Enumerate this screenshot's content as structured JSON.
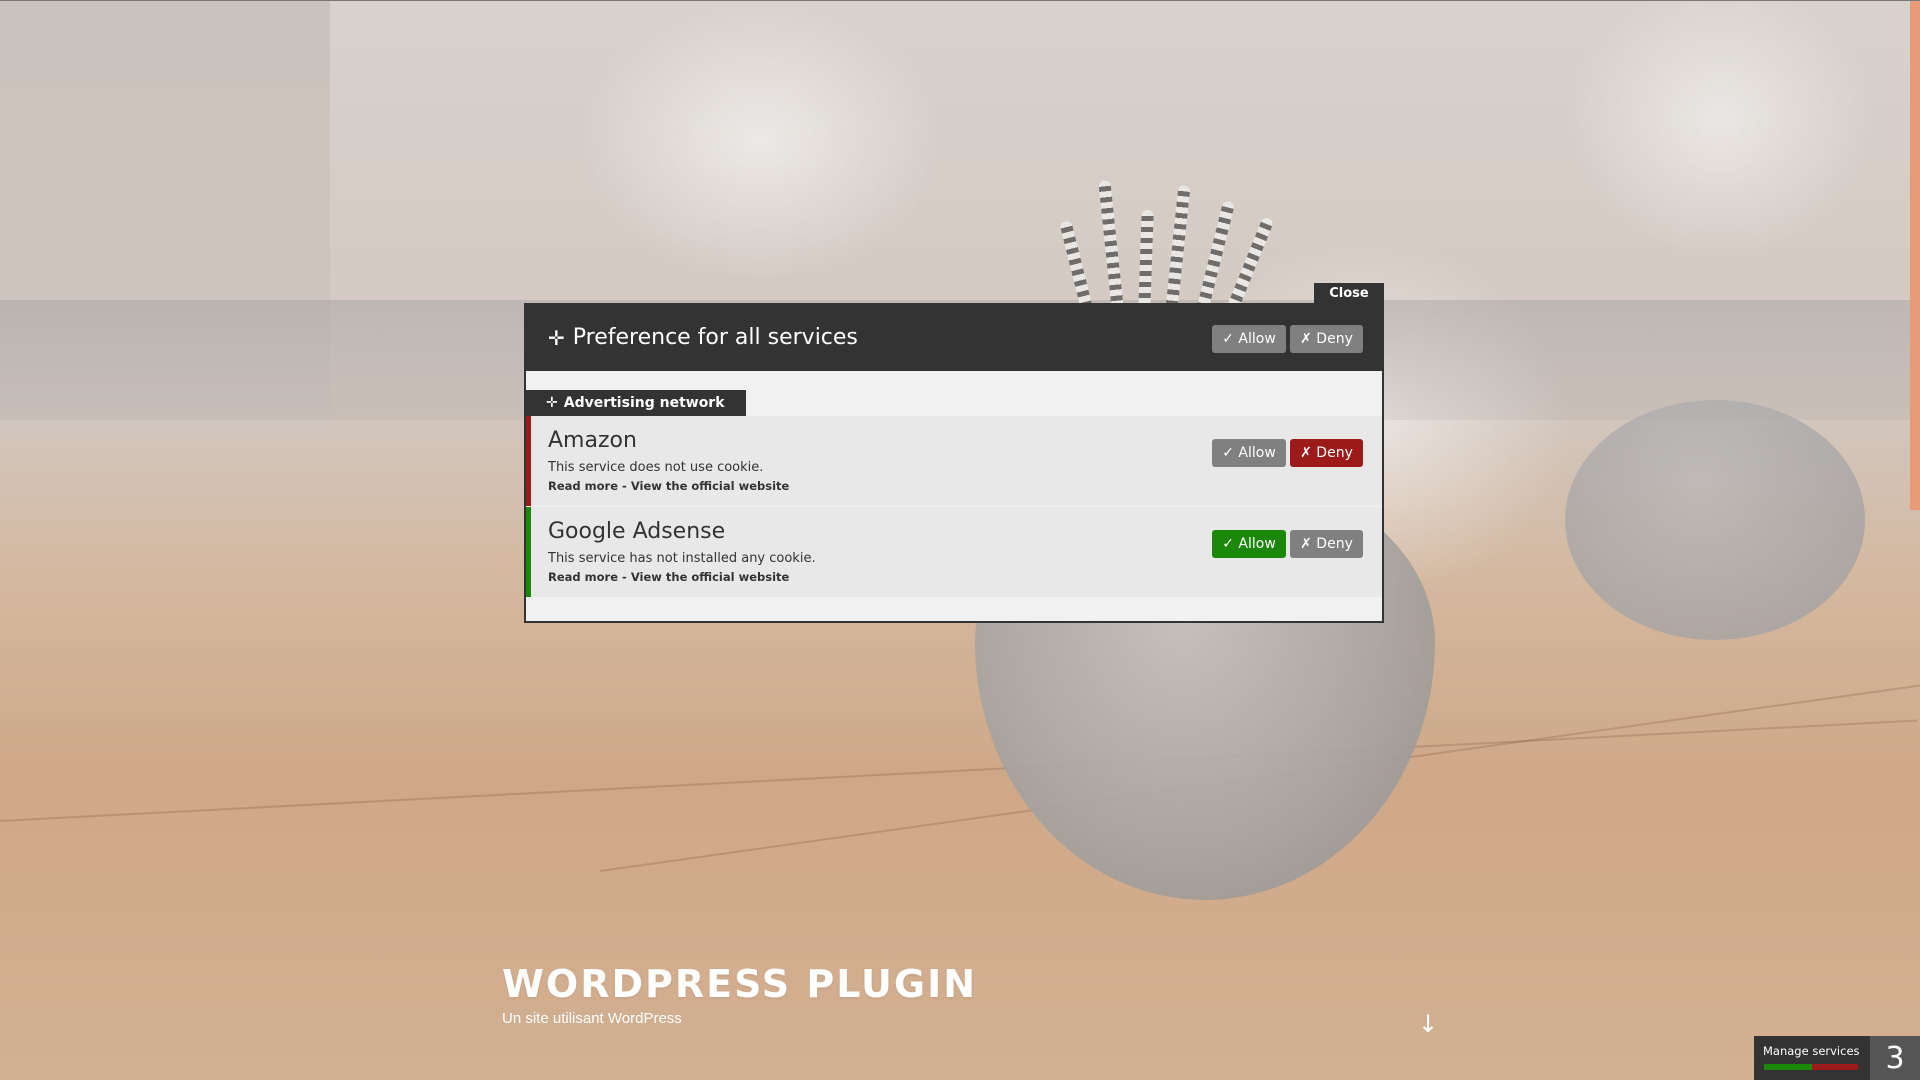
{
  "site": {
    "title": "WORDPRESS PLUGIN",
    "tagline": "Un site utilisant WordPress",
    "scroll_arrow": "↓"
  },
  "modal": {
    "close_label": "Close",
    "header": {
      "icon": "move-icon",
      "icon_glyph": "✛",
      "title": "Preference for all services",
      "allow_label": "✓ Allow",
      "deny_label": "✗ Deny"
    },
    "category": {
      "icon_glyph": "✛",
      "label": "Advertising network"
    },
    "services": [
      {
        "name": "Amazon",
        "description": "This service does not use cookie.",
        "read_more": "Read more",
        "separator": "-",
        "website": "View the official website",
        "allow_label": "✓ Allow",
        "deny_label": "✗ Deny",
        "status": "denied"
      },
      {
        "name": "Google Adsense",
        "description": "This service has not installed any cookie.",
        "read_more": "Read more",
        "separator": "-",
        "website": "View the official website",
        "allow_label": "✓ Allow",
        "deny_label": "✗ Deny",
        "status": "allowed"
      }
    ]
  },
  "manage_services": {
    "label": "Manage services",
    "count": "3"
  },
  "colors": {
    "allow": "#1b870b",
    "deny": "#9c1a1a",
    "neutral": "#808080",
    "dark": "#333333"
  }
}
